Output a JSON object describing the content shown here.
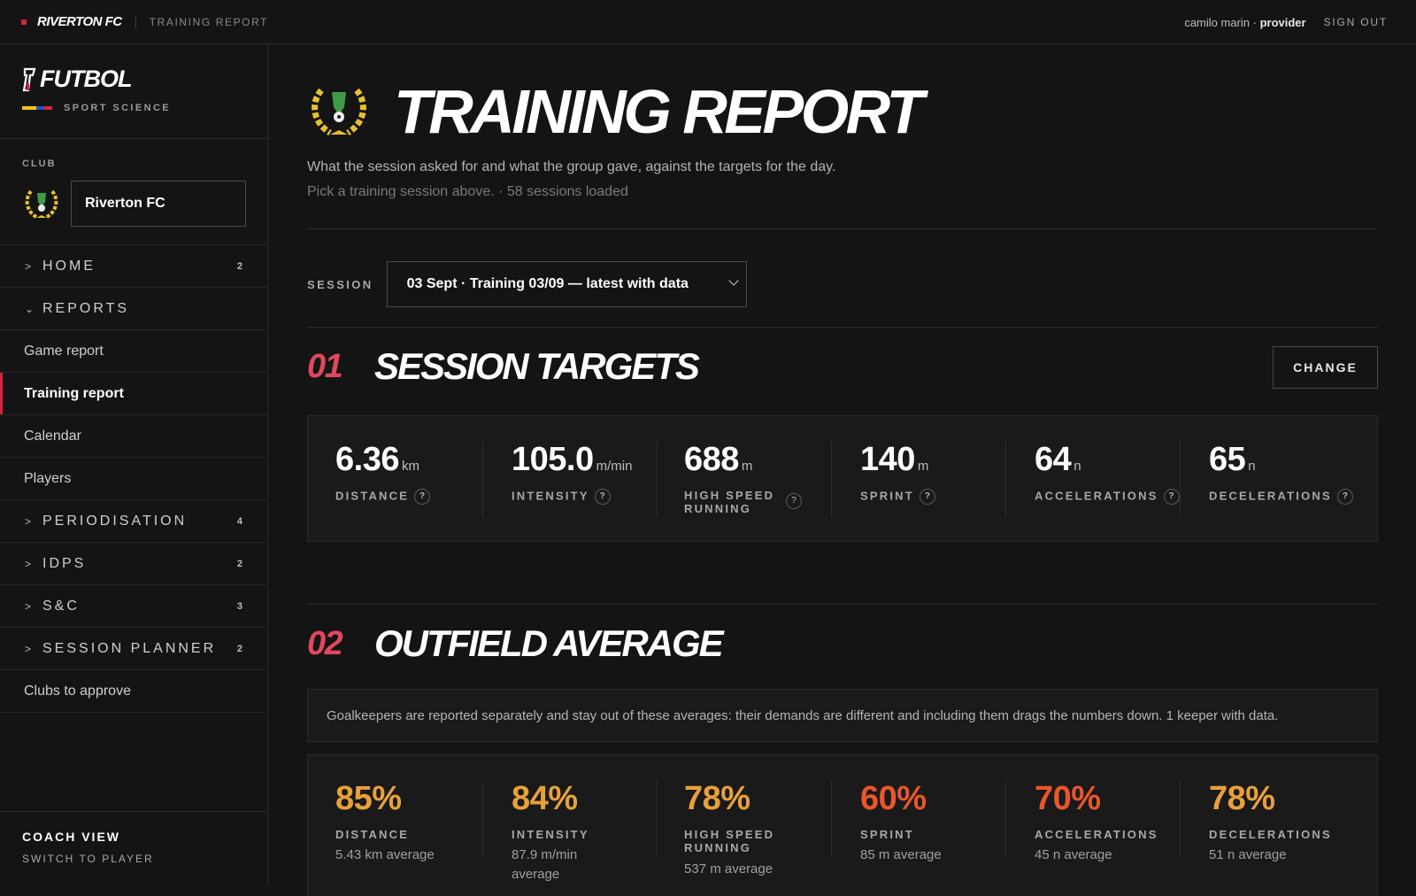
{
  "topbar": {
    "club": "RIVERTON FC",
    "crumb": "TRAINING REPORT",
    "user_name": "camilo marin",
    "user_role": "provider",
    "signout": "SIGN OUT"
  },
  "brand": {
    "name": "FUTBOL",
    "sub": "SPORT SCIENCE"
  },
  "club_selector": {
    "label": "CLUB",
    "value": "Riverton FC"
  },
  "nav": {
    "home": {
      "label": "HOME",
      "count": "2"
    },
    "reports": {
      "label": "REPORTS"
    },
    "game_report": "Game report",
    "training_report": "Training report",
    "calendar": "Calendar",
    "players": "Players",
    "periodisation": {
      "label": "PERIODISATION",
      "count": "4"
    },
    "idps": {
      "label": "IDPS",
      "count": "2"
    },
    "sc": {
      "label": "S&C",
      "count": "3"
    },
    "session_planner": {
      "label": "SESSION PLANNER",
      "count": "2"
    },
    "clubs_to_approve": "Clubs to approve"
  },
  "coach": {
    "title": "COACH VIEW",
    "switch": "SWITCH TO PLAYER"
  },
  "page": {
    "title": "TRAINING REPORT",
    "description": "What the session asked for and what the group gave, against the targets for the day.",
    "meta": "Pick a training session above. · 58 sessions loaded"
  },
  "session": {
    "label": "SESSION",
    "value": "03 Sept · Training 03/09 — latest with data"
  },
  "targets": {
    "num": "01",
    "title": "SESSION TARGETS",
    "change": "CHANGE",
    "metrics": [
      {
        "value": "6.36",
        "unit": "km",
        "name": "DISTANCE"
      },
      {
        "value": "105.0",
        "unit": "m/min",
        "name": "INTENSITY"
      },
      {
        "value": "688",
        "unit": "m",
        "name_line1": "HIGH SPEED",
        "name_line2": "RUNNING"
      },
      {
        "value": "140",
        "unit": "m",
        "name": "SPRINT"
      },
      {
        "value": "64",
        "unit": "n",
        "name": "ACCELERATIONS"
      },
      {
        "value": "65",
        "unit": "n",
        "name": "DECELERATIONS"
      }
    ],
    "help": "?"
  },
  "outfield": {
    "num": "02",
    "title": "OUTFIELD AVERAGE",
    "note": "Goalkeepers are reported separately and stay out of these averages: their demands are different and including them drags the numbers down. 1 keeper with data.",
    "metrics": [
      {
        "pct": "85%",
        "name": "DISTANCE",
        "avg": "5.43 km average",
        "color": "#e8a13a"
      },
      {
        "pct": "84%",
        "name": "INTENSITY",
        "avg_line1": "87.9 m/min",
        "avg_line2": "average",
        "color": "#e8a13a"
      },
      {
        "pct": "78%",
        "name_line1": "HIGH SPEED",
        "name_line2": "RUNNING",
        "avg": "537 m average",
        "color": "#e8a13a"
      },
      {
        "pct": "60%",
        "name": "SPRINT",
        "avg": "85 m average",
        "color": "#e8572c"
      },
      {
        "pct": "70%",
        "name": "ACCELERATIONS",
        "avg": "45 n average",
        "color": "#e8572c"
      },
      {
        "pct": "78%",
        "name": "DECELERATIONS",
        "avg": "51 n average",
        "color": "#e8a13a"
      }
    ]
  },
  "colors": {
    "accent": "#d8243c",
    "section_num": "#e0485e",
    "good": "#e8a13a",
    "warn": "#e8572c"
  }
}
